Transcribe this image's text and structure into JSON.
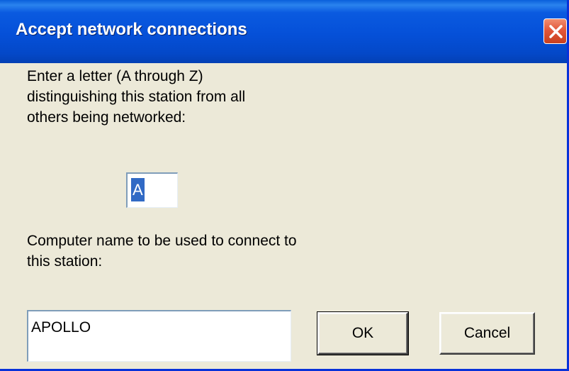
{
  "window": {
    "title": "Accept network connections"
  },
  "prompt": {
    "letter_instructions": "Enter a letter (A through Z)\ndistinguishing this station from all\nothers being networked:",
    "letter_value": "A",
    "name_instructions": "Computer name to be used to connect to\nthis station:",
    "name_value": "APOLLO"
  },
  "buttons": {
    "ok": "OK",
    "cancel": "Cancel"
  },
  "icons": {
    "close": "close-icon"
  },
  "colors": {
    "title_bar": "#0550d8",
    "close_button": "#e2573a",
    "dialog_face": "#ece9d8",
    "selection": "#316ac5",
    "field_border": "#7f9db9"
  }
}
